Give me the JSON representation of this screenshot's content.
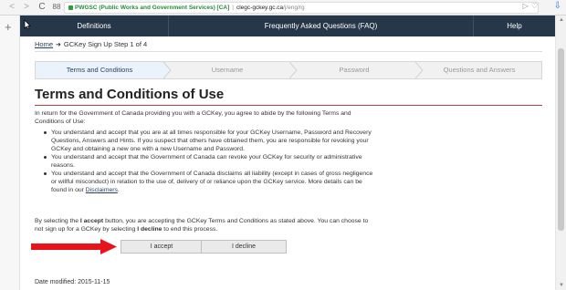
{
  "browser": {
    "back_glyph": "<",
    "forward_glyph": ">",
    "reload_glyph": "C",
    "grid_glyph": "88",
    "site_identity": "PWGSC (Public Works and Government Services) [CA]",
    "url_host": "clegc-gckey.gc.ca",
    "url_path": "/j/eng/rg",
    "right_glyphs": "▷♡",
    "download_glyph": "⇩",
    "plus_glyph": "+"
  },
  "topnav": {
    "definitions": "Definitions",
    "faq": "Frequently Asked Questions (FAQ)",
    "help": "Help"
  },
  "breadcrumb": {
    "home": "Home",
    "arrow": "➜",
    "current": "GCKey Sign Up Step 1 of 4"
  },
  "steps": [
    {
      "label": "Terms and Conditions",
      "active": true
    },
    {
      "label": "Username",
      "active": false
    },
    {
      "label": "Password",
      "active": false
    },
    {
      "label": "Questions and Answers",
      "active": false
    }
  ],
  "title": "Terms and Conditions of Use",
  "intro": "In return for the Government of Canada providing you with a GCKey, you agree to abide by the following Terms and Conditions of Use:",
  "bullets": [
    "You understand and accept that you are at all times responsible for your GCKey Username, Password and Recovery Questions, Answers and Hints. If you suspect that others have obtained them, you are responsible for revoking your GCKey and obtaining a new one with a new Username and Password.",
    "You understand and accept that the Government of Canada can revoke your GCKey for security or administrative reasons."
  ],
  "bullet3": {
    "text": "You understand and accept that the Government of Canada disclaims all liability (except in cases of gross negligence or willful misconduct) in relation to the use of, delivery of or reliance upon the GCKey service. More details can be found in our ",
    "link": "Disclaimers",
    "end": "."
  },
  "accept_text": {
    "part1": "By selecting the ",
    "accept_bold": "I accept",
    "part2": " button, you are accepting the GCKey Terms and Conditions as stated above. You can choose to not sign up for a GCKey by selecting ",
    "decline_bold": "I decline",
    "part3": " to end this process."
  },
  "buttons": {
    "accept": "I accept",
    "decline": "I decline"
  },
  "date_modified": "Date modified: 2015-11-15",
  "colors": {
    "nav_bg": "#26374a",
    "title_rule": "#a94442",
    "annotation_arrow": "#e8141b",
    "link": "#284162"
  }
}
